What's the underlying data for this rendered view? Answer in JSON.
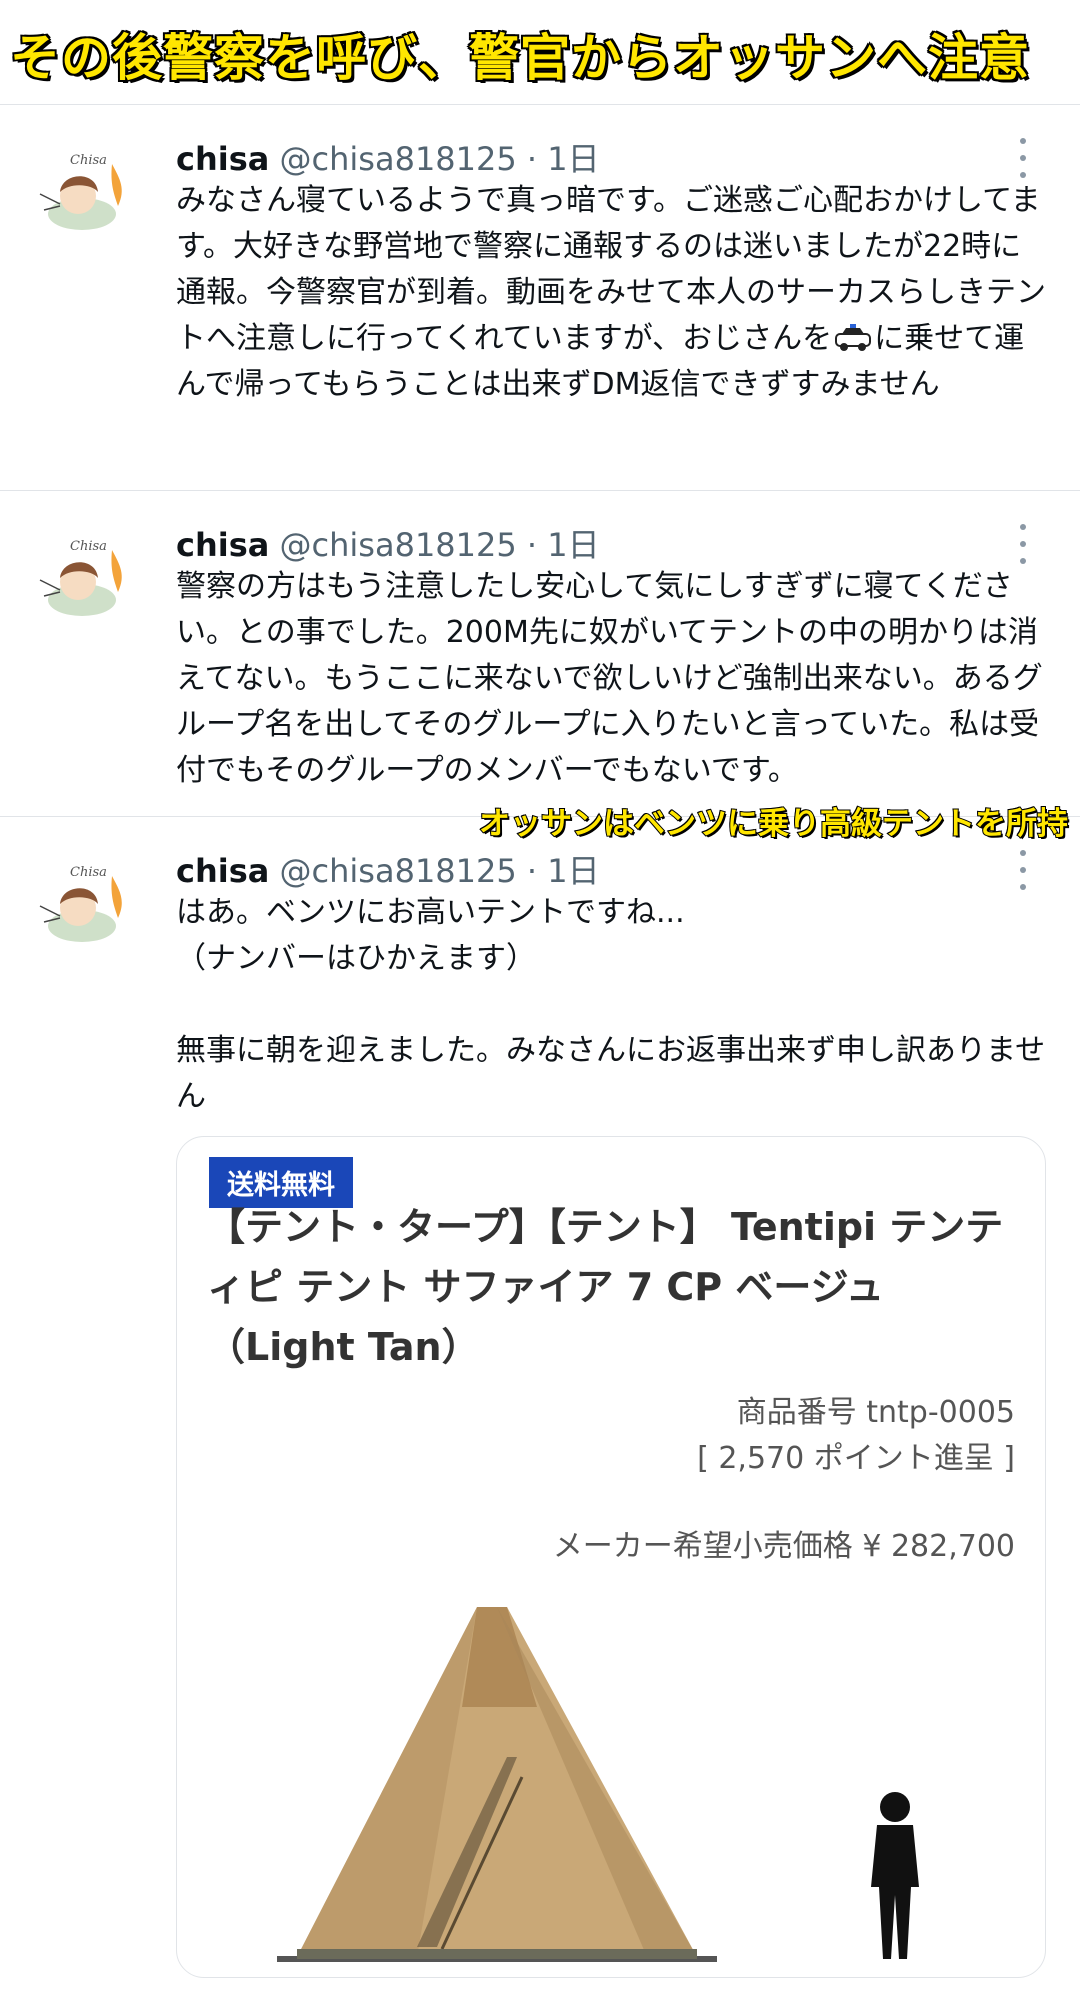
{
  "caption": "その後警察を呼び、警官からオッサンへ注意",
  "overlay_caption": "オッサンはベンツに乗り高級テントを所持",
  "tweets": [
    {
      "name": "chisa",
      "handle": "@chisa818125",
      "dot": "·",
      "age": "1日",
      "text_before_icon": "みなさん寝ているようで真っ暗です。ご迷惑ご心配おかけしてます。大好きな野営地で警察に通報するのは迷いましたが22時に通報。今警察官が到着。動画をみせて本人のサーカスらしきテントへ注意しに行ってくれていますが、おじさんを",
      "text_after_icon": "に乗せて運んで帰ってもらうことは出来ずDM返信できずすみません"
    },
    {
      "name": "chisa",
      "handle": "@chisa818125",
      "dot": "·",
      "age": "1日",
      "text": "警察の方はもう注意したし安心して気にしすぎずに寝てください。との事でした。200M先に奴がいてテントの中の明かりは消えてない。もうここに来ないで欲しいけど強制出来ない。あるグループ名を出してそのグループに入りたいと言っていた。私は受付でもそのグループのメンバーでもないです。"
    },
    {
      "name": "chisa",
      "handle": "@chisa818125",
      "dot": "·",
      "age": "1日",
      "text_line1": "はあ。ベンツにお高いテントですね...",
      "text_line2": "（ナンバーはひかえます）",
      "text_line3": "無事に朝を迎えました。みなさんにお返事出来ず申し訳ありません"
    }
  ],
  "avatar_label": "Chisa",
  "product_card": {
    "badge": "送料無料",
    "title": "【テント・タープ】【テント】 Tentipi テンティピ テント サファイア 7 CP ベージュ（Light Tan）",
    "product_number": "商品番号 tntp-0005",
    "points": "[ 2,570 ポイント進呈 ]",
    "price": "メーカー希望小売価格 ¥ 282,700"
  },
  "colors": {
    "caption_yellow": "#ffe600",
    "badge_blue": "#1a47b8",
    "tent_beige": "#c9a877"
  },
  "icons": [
    "more-options-icon",
    "police-car-icon"
  ]
}
